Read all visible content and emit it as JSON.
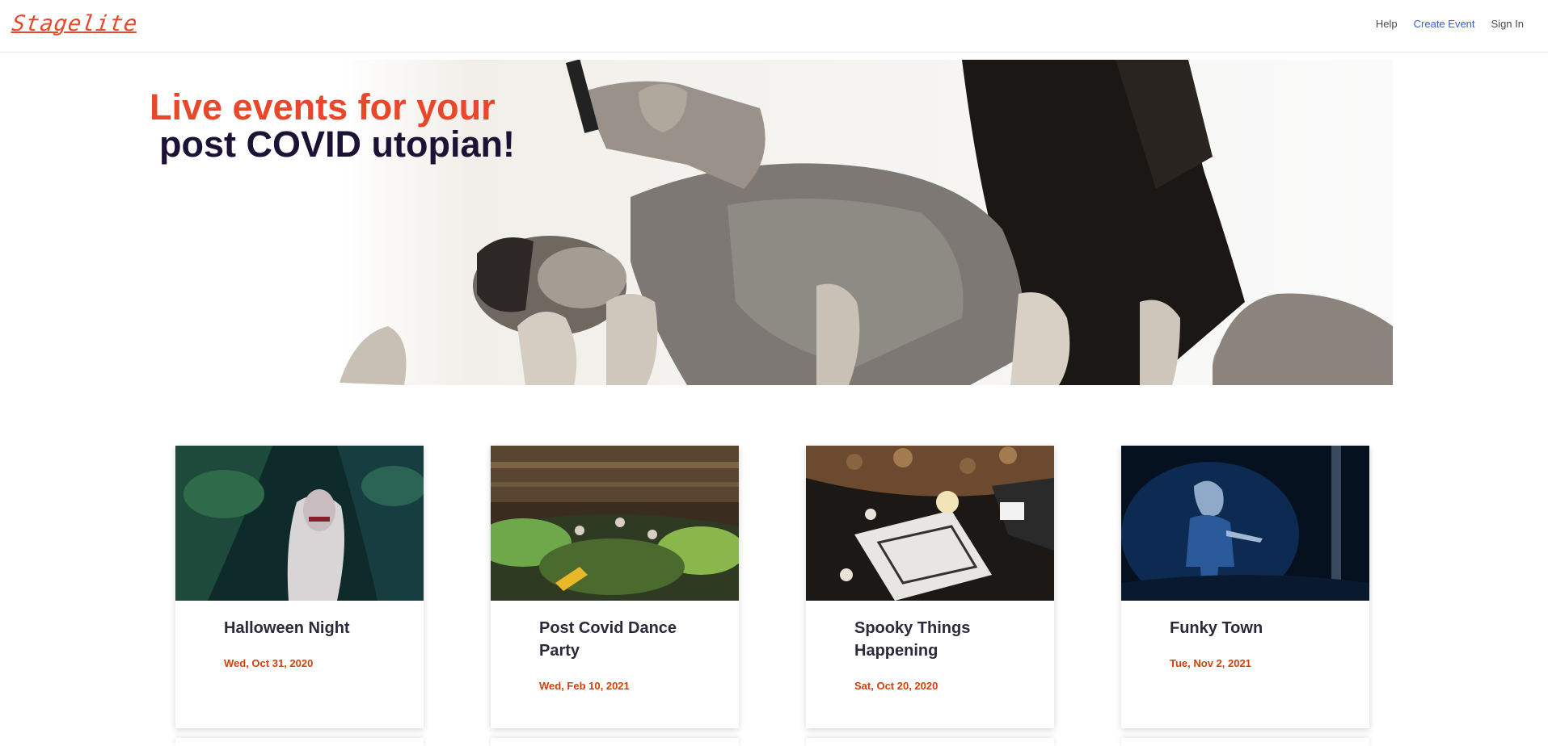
{
  "brand": {
    "logo_text": "Stagelite",
    "accent": "#e8472c",
    "link_color": "#3659e3"
  },
  "nav": {
    "help": "Help",
    "create_event": "Create Event",
    "sign_in": "Sign In"
  },
  "hero": {
    "line1": "Live events for your",
    "line2": "post COVID utopian!",
    "image": "crowd-surfing-singer-photo"
  },
  "events": [
    {
      "name": "Halloween Night",
      "date": "Wed, Oct 31, 2020",
      "image": "drag-performer-photo"
    },
    {
      "name": "Post Covid Dance Party",
      "date": "Wed, Feb 10, 2021",
      "image": "concert-crowd-photo"
    },
    {
      "name": "Spooky Things Happening",
      "date": "Sat, Oct 20, 2020",
      "image": "ouija-board-photo"
    },
    {
      "name": "Funky Town",
      "date": "Tue, Nov 2, 2021",
      "image": "masked-guitarist-photo"
    }
  ]
}
